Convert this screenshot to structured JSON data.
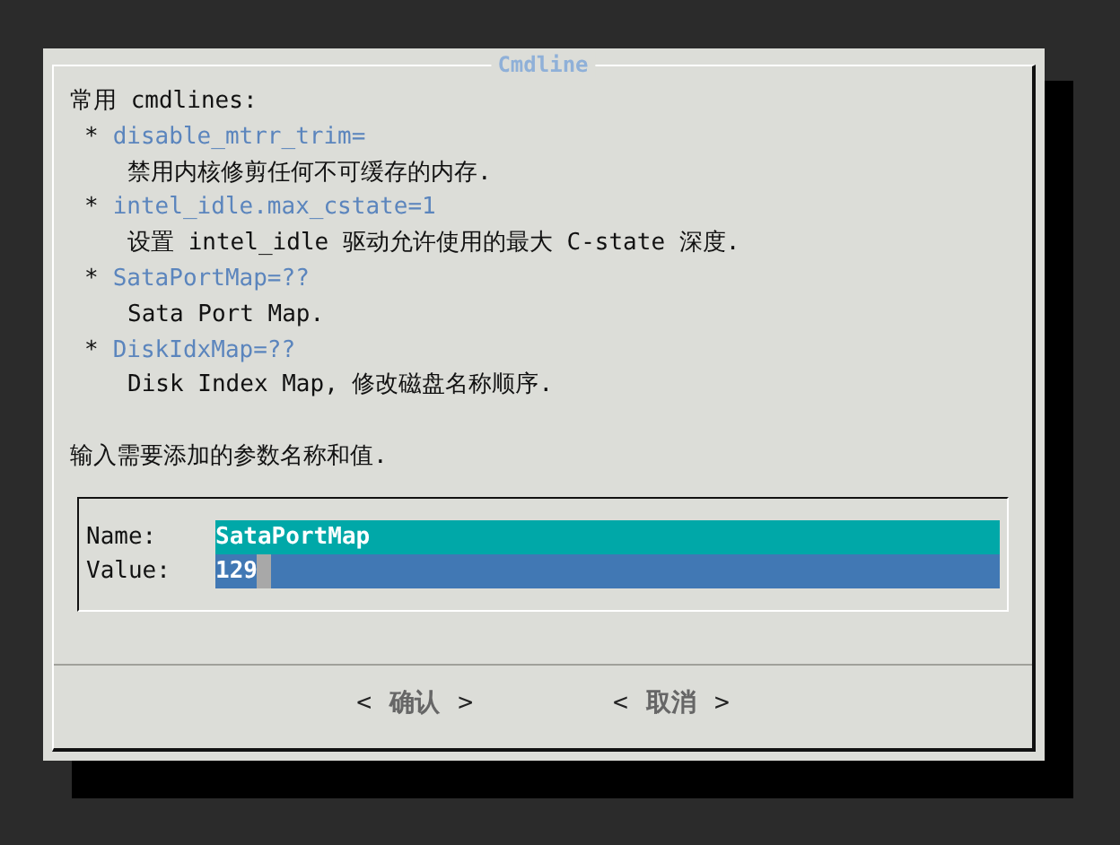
{
  "dialog": {
    "title": "Cmdline",
    "intro": "常用 cmdlines:",
    "options": [
      {
        "bullet": "*",
        "name": "disable_mtrr_trim=",
        "description": "禁用内核修剪任何不可缓存的内存."
      },
      {
        "bullet": "*",
        "name": "intel_idle.max_cstate=1",
        "description": "设置 intel_idle 驱动允许使用的最大 C-state 深度."
      },
      {
        "bullet": "*",
        "name": "SataPortMap=??",
        "description": "Sata Port Map."
      },
      {
        "bullet": "*",
        "name": "DiskIdxMap=??",
        "description": "Disk Index Map, 修改磁盘名称顺序."
      }
    ],
    "prompt": "输入需要添加的参数名称和值.",
    "fields": [
      {
        "label": "Name:",
        "value": "SataPortMap",
        "selected": false
      },
      {
        "label": "Value:",
        "value": "129",
        "selected": true
      }
    ],
    "buttons": [
      {
        "left": "<",
        "label": "确认",
        "right": ">"
      },
      {
        "left": "<",
        "label": "取消",
        "right": ">"
      }
    ]
  }
}
